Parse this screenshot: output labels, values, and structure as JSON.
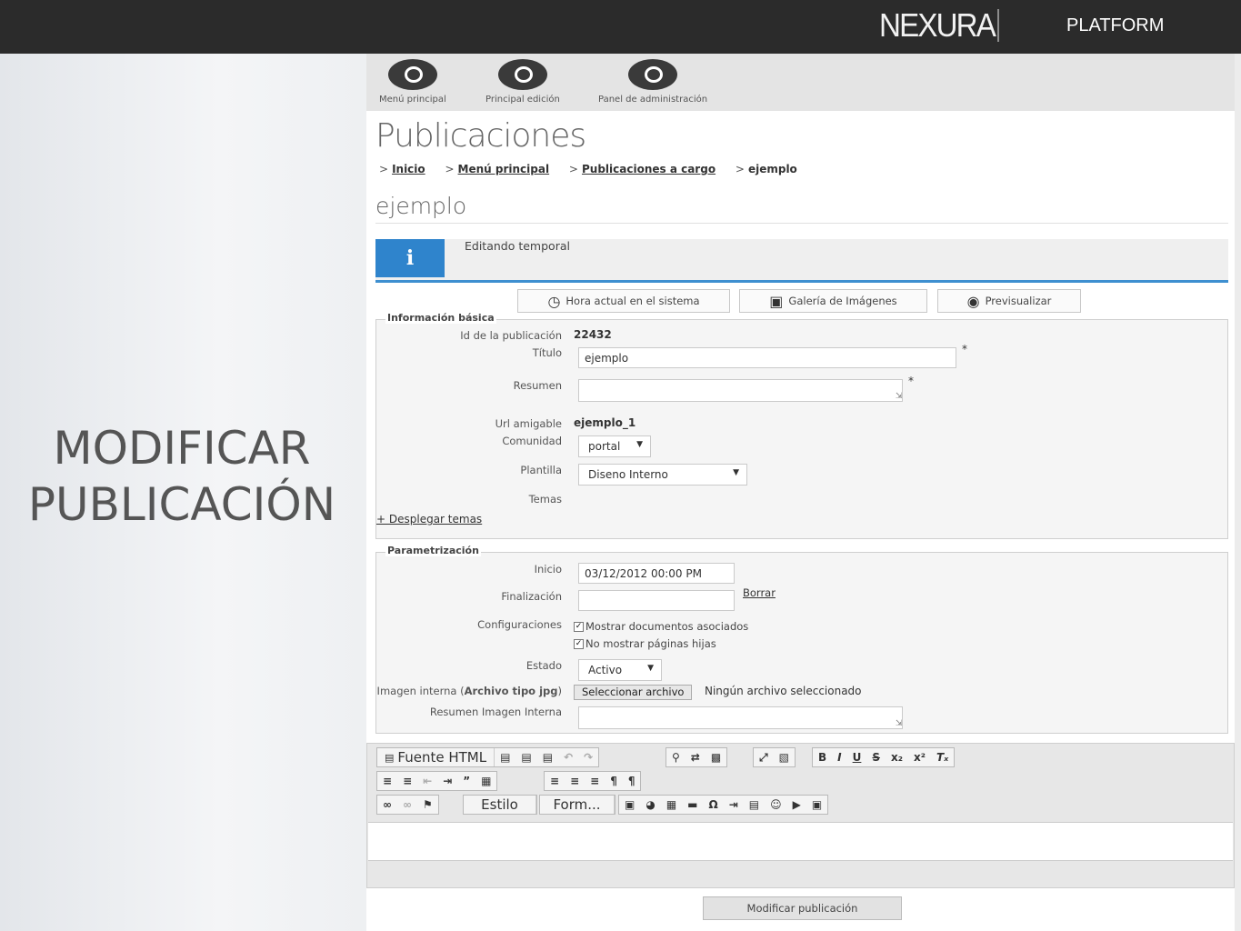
{
  "header": {
    "logo_text": "NEXURA",
    "product": "PLATFORM"
  },
  "slide": {
    "title_line1": "MODIFICAR",
    "title_line2": "PUBLICACIÓN"
  },
  "adminbar": {
    "buttons": [
      {
        "label": "Menú principal",
        "icon": "circle-icon"
      },
      {
        "label": "Principal edición",
        "icon": "circle-icon"
      },
      {
        "label": "Panel de administración",
        "icon": "circle-icon"
      }
    ]
  },
  "page": {
    "title": "Publicaciones",
    "breadcrumb": [
      {
        "label": "Inicio"
      },
      {
        "label": "Menú principal"
      },
      {
        "label": "Publicaciones a cargo"
      },
      {
        "label": "ejemplo"
      }
    ],
    "subtitle": "ejemplo",
    "info_icon_glyph": "i",
    "info_message": "Editando temporal"
  },
  "tools": {
    "hora_label": "Hora actual en el sistema",
    "galeria_label": "Galería de Imágenes",
    "preview_label": "Previsualizar"
  },
  "basic": {
    "legend": "Información básica",
    "id_label": "Id de la publicación",
    "id_value": "22432",
    "titulo_label": "Título",
    "titulo_value": "ejemplo",
    "resumen_label": "Resumen",
    "resumen_value": "",
    "url_label": "Url amigable",
    "url_value": "ejemplo_1",
    "comunidad_label": "Comunidad",
    "comunidad_value": "portal",
    "plantilla_label": "Plantilla",
    "plantilla_value": "Diseno Interno",
    "temas_label": "Temas",
    "desplegar_label": "+ Desplegar temas",
    "required_mark": "*"
  },
  "params": {
    "legend": "Parametrización",
    "inicio_label": "Inicio",
    "inicio_value": "03/12/2012 00:00 PM",
    "fin_label": "Finalización",
    "fin_value": "",
    "borrar_label": "Borrar",
    "config_label": "Configuraciones",
    "config_opt1": "Mostrar documentos asociados",
    "config_opt2": "No mostrar páginas hijas",
    "estado_label": "Estado",
    "estado_value": "Activo",
    "imagen_label_prefix": "Imagen interna (",
    "imagen_label_bold": "Archivo tipo jpg",
    "imagen_label_suffix": ")",
    "file_button": "Seleccionar archivo",
    "file_status": "Ningún archivo seleccionado",
    "resumen_img_label": "Resumen Imagen Interna",
    "resumen_img_value": ""
  },
  "editor": {
    "source_label": "Fuente HTML",
    "style_label": "Estilo",
    "format_label": "Form..."
  },
  "submit_label": "Modificar publicación"
}
